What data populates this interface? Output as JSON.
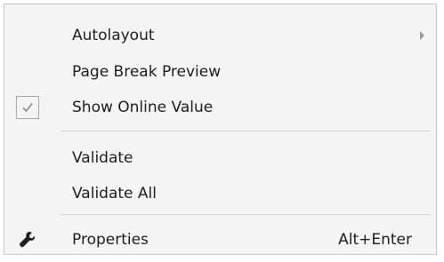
{
  "context_menu": {
    "items": [
      {
        "label": "Autolayout",
        "has_submenu": true
      },
      {
        "label": "Page Break Preview"
      },
      {
        "label": "Show Online Value",
        "checked": true,
        "check_glyph": "✓"
      },
      {
        "label": "Validate"
      },
      {
        "label": "Validate All"
      },
      {
        "label": "Properties",
        "shortcut": "Alt+Enter",
        "icon": "wrench-icon"
      }
    ]
  },
  "colors": {
    "menu_background": "#f5f5f5",
    "menu_border": "#c8c8c8",
    "text": "#1e1e1e",
    "separator": "#d6d6d6"
  }
}
